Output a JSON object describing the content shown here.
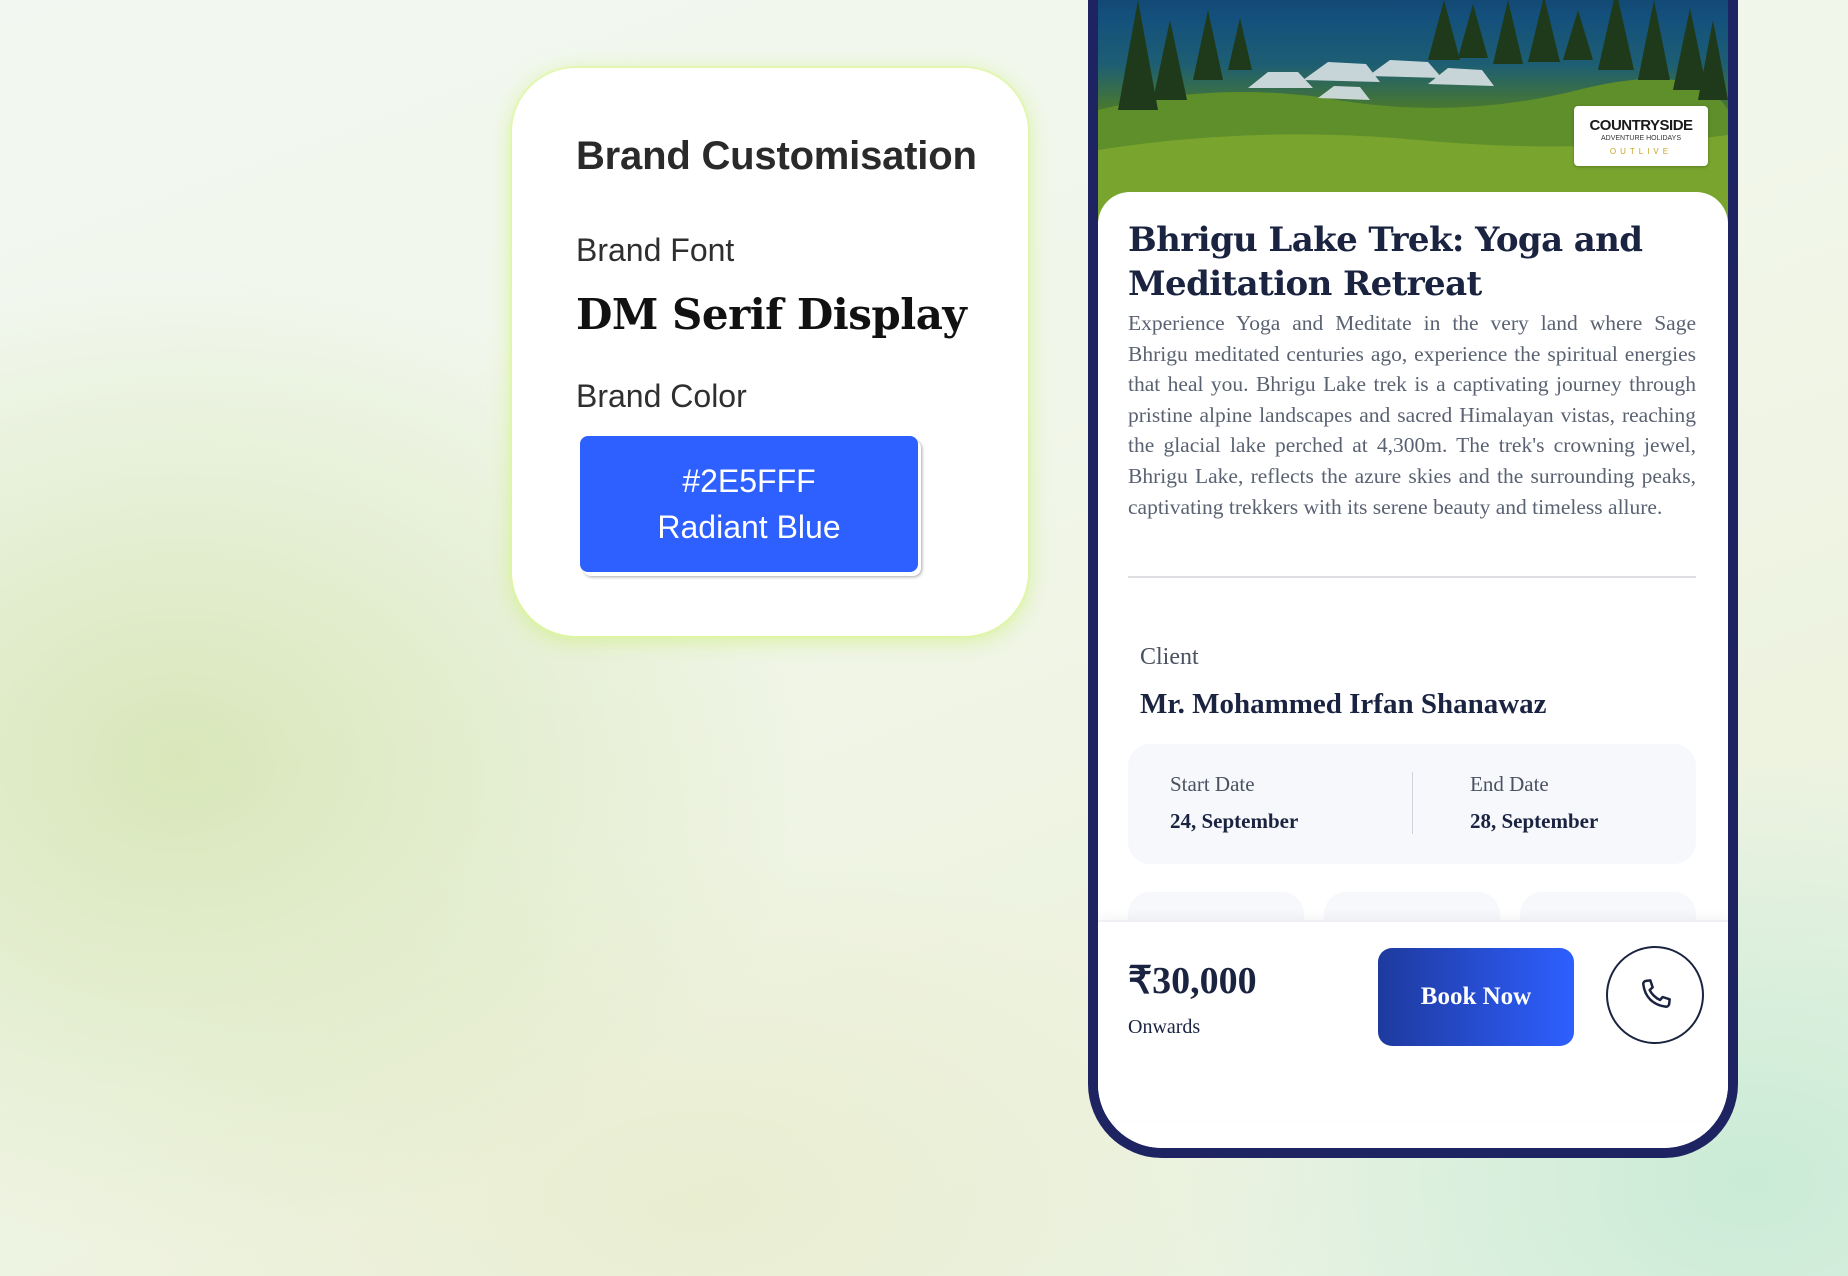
{
  "brand_card": {
    "title": "Brand Customisation",
    "font_label": "Brand Font",
    "font_value": "DM Serif Display",
    "color_label": "Brand Color",
    "color_hex": "#2E5FFF",
    "color_name": "Radiant Blue"
  },
  "trek": {
    "logo_main": "COUNTRYSIDE",
    "logo_sub": "ADVENTURE HOLIDAYS",
    "logo_tag": "OUTLIVE",
    "title": "Bhrigu Lake Trek: Yoga and Meditation Retreat",
    "description": "Experience Yoga and Meditate in the very land where Sage Bhrigu meditated centuries ago, experience the spiritual energies that heal you. Bhrigu Lake trek is a captivating journey through pristine alpine landscapes and sacred Himalayan vistas, reaching the glacial lake perched at 4,300m. The trek's crowning jewel, Bhrigu Lake, reflects the azure skies and the surrounding peaks, captivating trekkers with its serene beauty and timeless allure.",
    "client_label": "Client",
    "client_name": "Mr. Mohammed Irfan Shanawaz",
    "start_label": "Start Date",
    "start_value": "24, September",
    "end_label": "End Date",
    "end_value": "28, September",
    "features": [
      {
        "icon": "calendar-icon"
      },
      {
        "icon": "group-icon"
      },
      {
        "icon": "trekker-icon"
      }
    ],
    "price": "₹30,000",
    "price_sub": "Onwards",
    "book_label": "Book Now",
    "call_icon": "phone-icon"
  },
  "colors": {
    "brand": "#2E5FFF",
    "navy": "#1E2461",
    "text_dark": "#1A2340",
    "accent_orange": "#F5A524"
  }
}
